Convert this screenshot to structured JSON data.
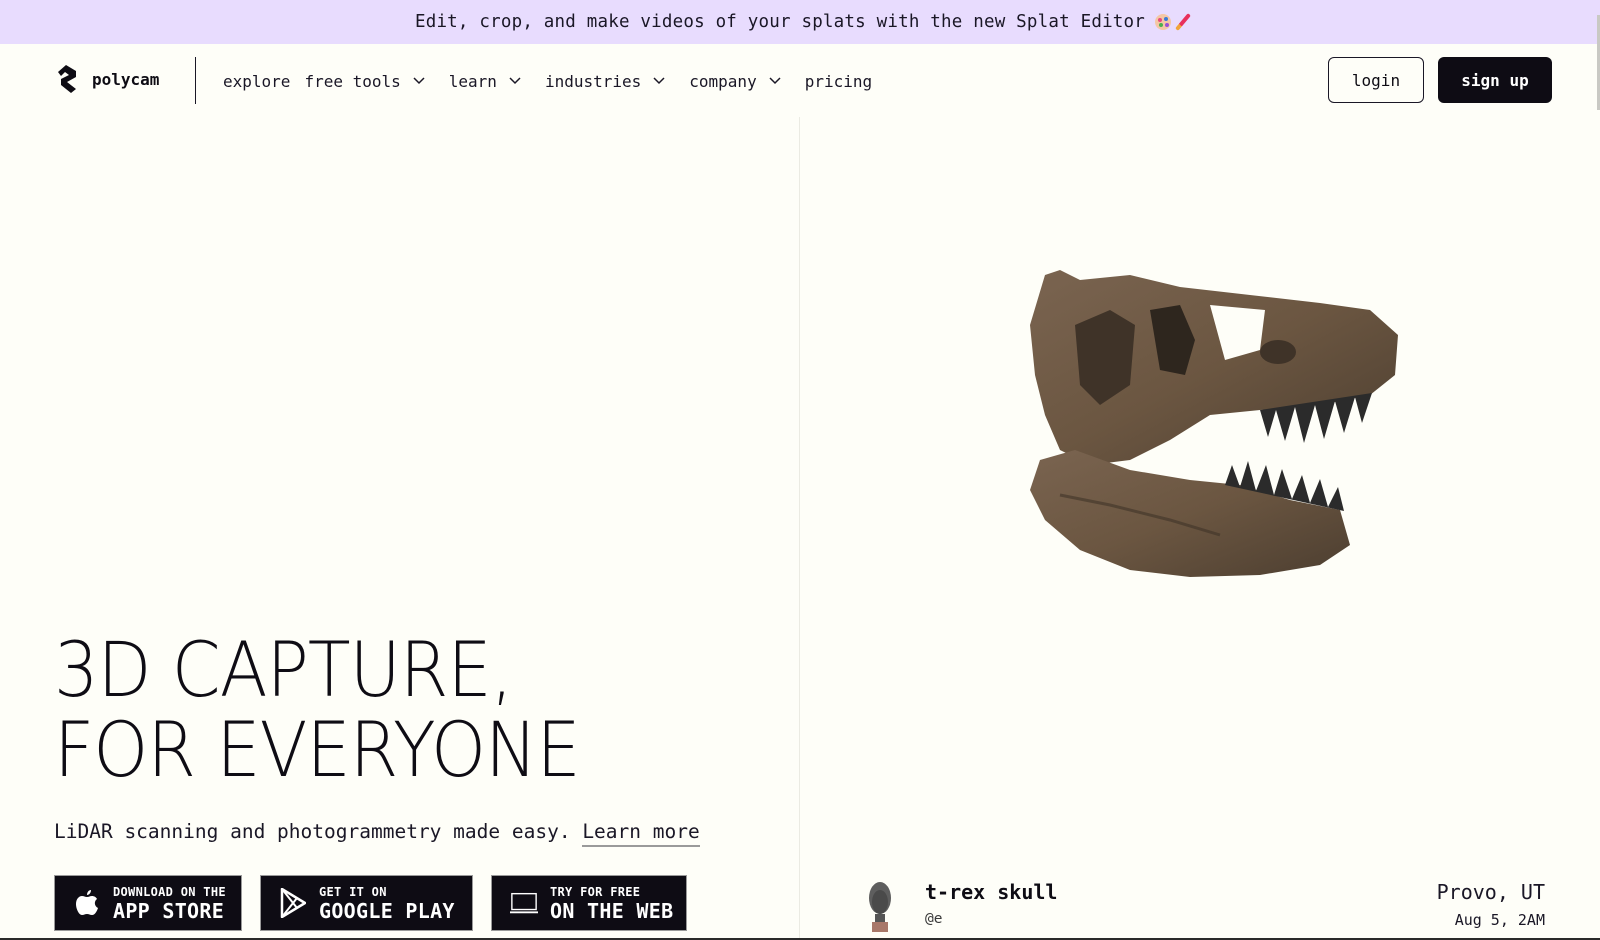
{
  "banner": {
    "text": "Edit, crop, and make videos of your splats with the new Splat Editor",
    "emoji_icons": [
      "artist-palette-icon",
      "paintbrush-icon"
    ]
  },
  "nav": {
    "brand": "polycam",
    "items": [
      {
        "label": "explore",
        "has_dropdown": false
      },
      {
        "label": "free tools",
        "has_dropdown": true
      },
      {
        "label": "learn",
        "has_dropdown": true
      },
      {
        "label": "industries",
        "has_dropdown": true
      },
      {
        "label": "company",
        "has_dropdown": true
      },
      {
        "label": "pricing",
        "has_dropdown": false
      }
    ],
    "login_label": "login",
    "signup_label": "sign up"
  },
  "hero": {
    "title_line1": "3D CAPTURE,",
    "title_line2": "FOR EVERYONE",
    "subtitle": "LiDAR scanning and photogrammetry made easy.",
    "learn_more": "Learn more",
    "buttons": [
      {
        "small": "DOWNLOAD ON THE",
        "big": "APP STORE",
        "icon": "apple-icon"
      },
      {
        "small": "GET IT ON",
        "big": "GOOGLE PLAY",
        "icon": "google-play-icon"
      },
      {
        "small": "TRY FOR FREE",
        "big": "ON THE WEB",
        "icon": "laptop-icon"
      }
    ]
  },
  "featured": {
    "title": "t-rex skull",
    "user": "@e",
    "location": "Provo, UT",
    "date": "Aug 5, 2AM",
    "colors": {
      "bone": "#6b5641",
      "bone_dark": "#3f3328",
      "teeth": "#2b2b2b"
    }
  },
  "theme": {
    "banner_bg": "#e8dcfe",
    "page_bg": "#fefef8",
    "ink": "#0e0c14"
  }
}
